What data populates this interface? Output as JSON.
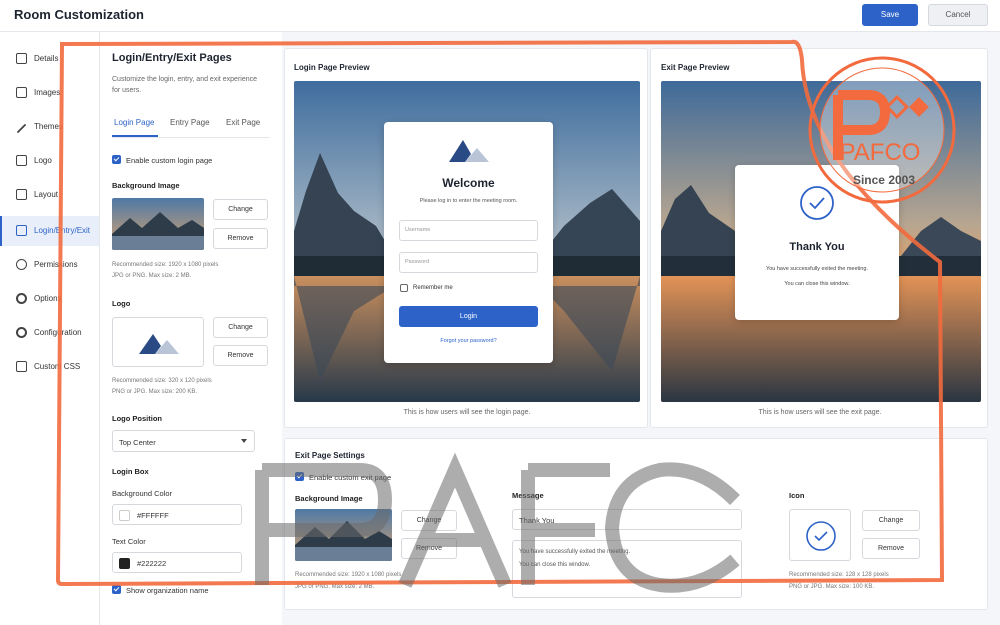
{
  "app": {
    "title": "Room Customization"
  },
  "toolbar": {
    "save_label": "Save",
    "cancel_label": "Cancel"
  },
  "sidebar": {
    "items": [
      {
        "label": "Details"
      },
      {
        "label": "Images"
      },
      {
        "label": "Themes"
      },
      {
        "label": "Logo"
      },
      {
        "label": "Layout"
      },
      {
        "label": "Login/Entry/Exit"
      },
      {
        "label": "Permissions"
      },
      {
        "label": "Options"
      },
      {
        "label": "Configuration"
      },
      {
        "label": "Custom CSS"
      }
    ]
  },
  "settings": {
    "title": "Login/Entry/Exit Pages",
    "description": "Customize the login, entry, and exit experience for users.",
    "tabs": [
      {
        "label": "Login Page"
      },
      {
        "label": "Entry Page"
      },
      {
        "label": "Exit Page"
      }
    ],
    "enable_custom_login": "Enable custom login page",
    "background_image": {
      "label": "Background Image",
      "change": "Change",
      "remove": "Remove",
      "hint1": "Recommended size: 1920 x 1080 pixels",
      "hint2": "JPG or PNG. Max size: 2 MB."
    },
    "logo": {
      "label": "Logo",
      "change": "Change",
      "remove": "Remove",
      "hint1": "Recommended size: 320 x 120 pixels",
      "hint2": "PNG or JPG. Max size: 200 KB."
    },
    "logo_position": {
      "label": "Logo Position",
      "value": "Top Center"
    },
    "login_box": {
      "label": "Login Box",
      "bg_color_label": "Background Color",
      "bg_color_value": "#FFFFFF",
      "text_color_label": "Text Color",
      "text_color_value": "#222222",
      "show_org_name": "Show organization name"
    }
  },
  "login_preview": {
    "title": "Login Page Preview",
    "welcome": "Welcome",
    "subtitle": "Please log in to enter the meeting room.",
    "username_placeholder": "Username",
    "password_placeholder": "Password",
    "remember": "Remember me",
    "login_button": "Login",
    "forgot": "Forgot your password?",
    "caption": "This is how users will see the login page."
  },
  "exit_preview": {
    "title": "Exit Page Preview",
    "thank": "Thank You",
    "line1": "You have successfully exited the meeting.",
    "line2": "You can close this window.",
    "caption": "This is how users will see the exit page."
  },
  "exit_settings": {
    "title": "Exit Page Settings",
    "enable": "Enable custom exit page",
    "background_label": "Background Image",
    "change": "Change",
    "remove": "Remove",
    "bg_hint1": "Recommended size: 1920 x 1080 pixels",
    "bg_hint2": "JPG or PNG. Max size: 2 MB.",
    "message_label": "Message",
    "message_title": "Thank You",
    "message_body1": "You have successfully exited the meeting.",
    "message_body2": "You can close this window.",
    "icon_label": "Icon",
    "icon_change": "Change",
    "icon_remove": "Remove",
    "icon_hint1": "Recommended size: 128 x 128 pixels",
    "icon_hint2": "PNG or JPG. Max size: 100 KB."
  },
  "watermark": {
    "brand": "PAFCO",
    "since": "Since 2003",
    "big_text": "PAFCO"
  },
  "colors": {
    "accent": "#2d63c8",
    "overlay": "#f26a3d"
  },
  "icons": [
    "details-icon",
    "image-icon",
    "brush-icon",
    "logo-icon",
    "layout-icon",
    "login-icon",
    "permissions-icon",
    "options-icon",
    "configuration-icon",
    "css-icon",
    "checkmark-circle-icon",
    "mountain-logo-icon"
  ]
}
